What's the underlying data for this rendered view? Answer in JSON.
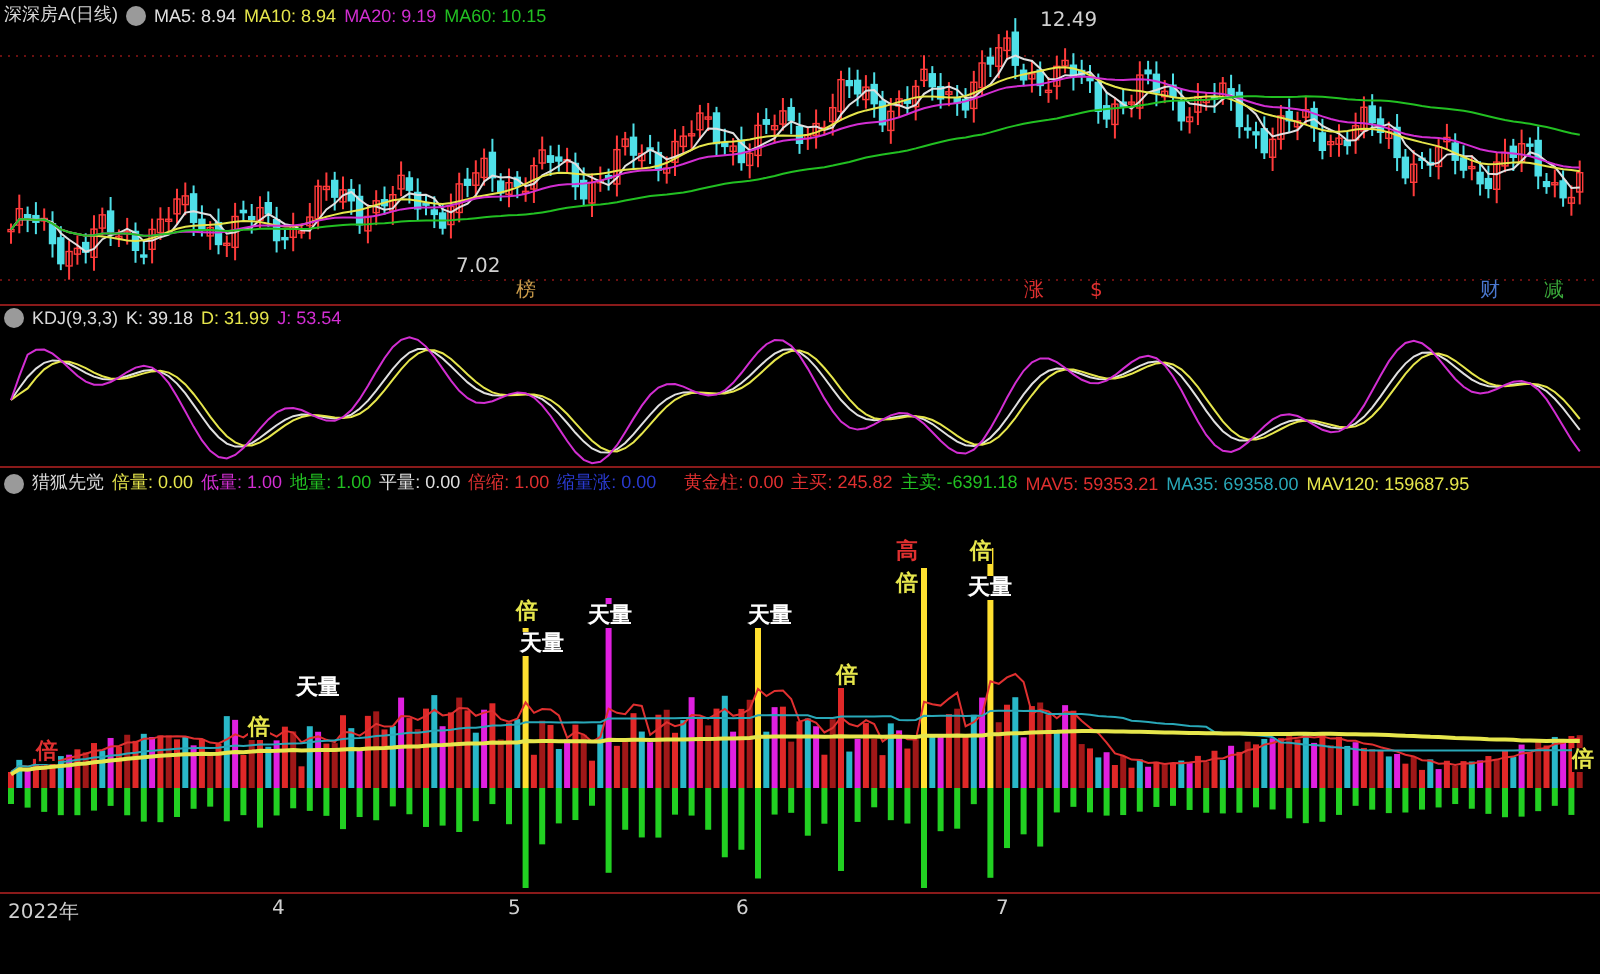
{
  "price_panel": {
    "title": "深深房A(日线)",
    "indicators": [
      {
        "label": "MA5: 8.94",
        "color": "#e0e0e0"
      },
      {
        "label": "MA10: 8.94",
        "color": "#e6e64c"
      },
      {
        "label": "MA20: 9.19",
        "color": "#d22ed2"
      },
      {
        "label": "MA60: 10.15",
        "color": "#22c022"
      }
    ],
    "high_label": "12.49",
    "low_label": "7.02",
    "event_tags": [
      {
        "text": "榜",
        "color": "#c89a4a"
      },
      {
        "text": "涨",
        "color": "#e03030"
      },
      {
        "text": "$",
        "color": "#e03030"
      },
      {
        "text": "财",
        "color": "#4a78d0"
      },
      {
        "text": "减",
        "color": "#3aa83a"
      }
    ]
  },
  "kdj_panel": {
    "title": "KDJ(9,3,3)",
    "indicators": [
      {
        "label": "K: 39.18",
        "color": "#e0e0e0"
      },
      {
        "label": "D: 31.99",
        "color": "#e6e64c"
      },
      {
        "label": "J: 53.54",
        "color": "#d22ed2"
      }
    ]
  },
  "volume_panel": {
    "title": "猎狐先觉",
    "indicators": [
      {
        "label": "倍量: 0.00",
        "color": "#e6e64c"
      },
      {
        "label": "低量: 1.00",
        "color": "#d22ed2"
      },
      {
        "label": "地量: 1.00",
        "color": "#22c022"
      },
      {
        "label": "平量: 0.00",
        "color": "#e0e0e0"
      },
      {
        "label": "倍缩: 1.00",
        "color": "#e03030"
      },
      {
        "label": "缩量涨: 0.00",
        "color": "#2a3ad0"
      },
      {
        "label": "黄金柱: 0.00",
        "color": "#e03030"
      },
      {
        "label": "主买: 245.82",
        "color": "#e03030"
      },
      {
        "label": "主卖: -6391.18",
        "color": "#22c022"
      },
      {
        "label": "MAV5: 59353.21",
        "color": "#e03030"
      },
      {
        "label": "MA35: 69358.00",
        "color": "#29a8b8"
      },
      {
        "label": "MAV120: 159687.95",
        "color": "#e6e64c"
      }
    ],
    "marks": [
      {
        "text": "倍",
        "color": "#e03030"
      },
      {
        "text": "倍",
        "color": "#e6e64c"
      },
      {
        "text": "天量",
        "color": "#ffffff"
      },
      {
        "text": "倍",
        "color": "#e6e64c"
      },
      {
        "text": "天量",
        "color": "#ffffff"
      },
      {
        "text": "天量",
        "color": "#ffffff"
      },
      {
        "text": "天量",
        "color": "#ffffff"
      },
      {
        "text": "倍",
        "color": "#e6e64c"
      },
      {
        "text": "高",
        "color": "#e03030"
      },
      {
        "text": "倍",
        "color": "#e6e64c"
      },
      {
        "text": "倍",
        "color": "#e6e64c"
      },
      {
        "text": "天量",
        "color": "#ffffff"
      },
      {
        "text": "倍",
        "color": "#e6e64c"
      }
    ]
  },
  "axis_labels": [
    "2022年",
    "4",
    "5",
    "6",
    "7"
  ]
}
